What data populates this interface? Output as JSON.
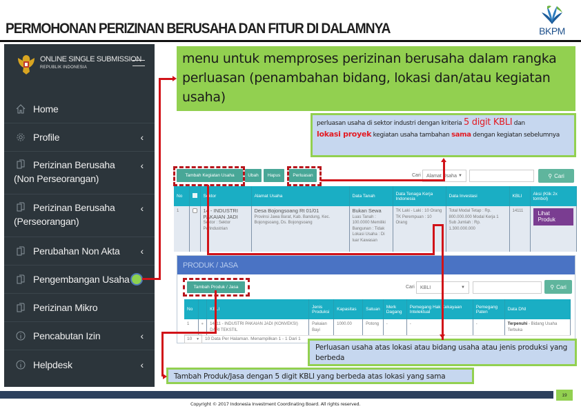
{
  "slide": {
    "title": "PERMOHONAN PERIZINAN BERUSAHA DAN FITUR DI DALAMNYA",
    "logo_text": "BKPM",
    "page_number": "19",
    "copyright": "Copyright © 2017 Indonesia Investment Coordinating Board. All rights reserved."
  },
  "sidebar": {
    "brand_title": "ONLINE SINGLE SUBMISSION",
    "brand_subtitle": "REPUBLIK INDONESIA",
    "items": [
      {
        "label": "Home",
        "icon": "home-icon",
        "has_chevron": false
      },
      {
        "label": "Profile",
        "icon": "gear-icon",
        "has_chevron": true
      },
      {
        "label": "Perizinan Berusaha",
        "label2": "(Non Perseorangan)",
        "icon": "document-icon",
        "has_chevron": true
      },
      {
        "label": "Perizinan Berusaha",
        "label2": "(Perseorangan)",
        "icon": "document-icon",
        "has_chevron": true
      },
      {
        "label": "Perubahan Non Akta",
        "icon": "document-icon",
        "has_chevron": true
      },
      {
        "label": "Pengembangan Usaha",
        "icon": "document-icon",
        "has_chevron": false,
        "highlighted": true
      },
      {
        "label": "Perizinan Mikro",
        "icon": "document-icon",
        "has_chevron": false
      },
      {
        "label": "Pencabutan Izin",
        "icon": "info-icon",
        "has_chevron": true
      },
      {
        "label": "Helpdesk",
        "icon": "info-icon",
        "has_chevron": true
      }
    ],
    "chevron": "‹"
  },
  "callouts": {
    "main": "menu untuk memproses perizinan berusaha dalam rangka perluasan (penambahan bidang, lokasi dan/atau kegiatan usaha)",
    "kbli": {
      "part1": "perluasan usaha di sektor industri dengan kriteria ",
      "highlight1": "5 digit KBLI",
      "part2": " dan ",
      "highlight2": "lokasi proyek",
      "part3": " kegiatan usaha tambahan ",
      "highlight3": "sama",
      "part4": " dengan kegiatan sebelumnya"
    },
    "lokasi": "Perluasan usaha atas lokasi atau bidang usaha atau jenis produksi yang berbeda",
    "produk": "Tambah Produk/Jasa dengan 5 digit KBLI yang berbeda atas lokasi yang sama"
  },
  "app": {
    "toolbar": {
      "add_activity": "Tambah Kegiatan Usaha",
      "edit": "Ubah",
      "delete": "Hapus",
      "expand": "Perluasan",
      "search_label": "Cari",
      "search_field": "Alamat Usaha",
      "search_value": "",
      "search_button": "Cari"
    },
    "main_table": {
      "columns": [
        "No",
        "",
        "Sektor",
        "Alamat Usaha",
        "Data Tanah",
        "Data Tenaga Kerja Indonesia",
        "Data Investasi",
        "KBLI",
        "Aksi (Klik 2x tombol)"
      ],
      "rows": [
        {
          "no": "1",
          "sektor": "14 - INDUSTRI PAKAIAN JADI",
          "sektor_sub": "Sektor : Sektor Perindustrian",
          "alamat": "Desa Bojongsoang Rt 01/01",
          "alamat_sub": "Provinsi Jawa Barat, Kab. Bandung, Kec. Bojongsoang, Ds. Bojongsoang",
          "tanah": "Bukan Sewa",
          "tanah_sub": "Luas Tanah : 100.0000 Memiliki Bangunan : Tidak Lokasi Usaha : Di luar Kawasan",
          "tenaga_kerja": "TK Laki - Laki : 10 Orang TK Perempuan : 10 Orang",
          "investasi": "Total Modal Tetap : Rp. 800.000.000 Modal Kerja 1 Sub Jumlah : Rp. 1.300.000.000",
          "kbli": "14111",
          "action": "Lihat Produk"
        }
      ]
    },
    "product_panel": {
      "title": "PRODUK / JASA",
      "add_button": "Tambah Produk / Jasa",
      "search_label": "Cari",
      "search_field": "KBLI",
      "search_value": "",
      "search_button": "Cari",
      "columns": [
        "No",
        "",
        "KBLI",
        "Jenis Produksi",
        "Kapasitas",
        "Satuan",
        "Merk Dagang",
        "Pemegang Hak Kekayaan Intelektual",
        "Pemegang Paten",
        "Data DNI"
      ],
      "rows": [
        {
          "no": "1",
          "kbli": "14111 - INDUSTRI PAKAIAN JADI (KONVEKSI) DARI TEKSTIL",
          "jenis": "Pakaian Bayi",
          "kapasitas": "1000.00",
          "satuan": "Potong",
          "merk": "-",
          "hki": "-",
          "paten": "-",
          "dni_status": "Terpenuhi",
          "dni_text": " - Bidang Usaha Terbuka"
        }
      ],
      "page_size": "10",
      "pagination_text": "10 Data Per Halaman. Menampilkan 1 - 1 Dari 1"
    }
  },
  "colors": {
    "accent_green": "#92d050",
    "callout_blue": "#c6d7ef",
    "connector_red": "#d11218",
    "sidebar_bg": "#2c353b",
    "table_header": "#1aaec4",
    "button_teal": "#48a797",
    "button_purple": "#7a3d91",
    "panel_blue": "#4a73c4"
  }
}
